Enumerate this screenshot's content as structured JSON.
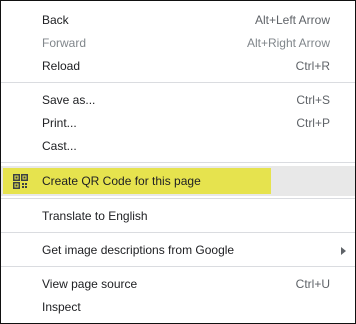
{
  "menu": {
    "back": {
      "label": "Back",
      "shortcut": "Alt+Left Arrow"
    },
    "forward": {
      "label": "Forward",
      "shortcut": "Alt+Right Arrow",
      "disabled": true
    },
    "reload": {
      "label": "Reload",
      "shortcut": "Ctrl+R"
    },
    "save_as": {
      "label": "Save as...",
      "shortcut": "Ctrl+S"
    },
    "print": {
      "label": "Print...",
      "shortcut": "Ctrl+P"
    },
    "cast": {
      "label": "Cast..."
    },
    "qr_code": {
      "label": "Create QR Code for this page",
      "icon": "qr-code-icon",
      "highlighted": true
    },
    "translate": {
      "label": "Translate to English"
    },
    "image_descriptions": {
      "label": "Get image descriptions from Google",
      "has_submenu": true
    },
    "view_source": {
      "label": "View page source",
      "shortcut": "Ctrl+U"
    },
    "inspect": {
      "label": "Inspect"
    }
  },
  "colors": {
    "highlight": "#e6e34e",
    "hover_background": "#e8e8e8",
    "separator": "#dadce0",
    "text": "#202124",
    "shortcut_text": "#5f6368",
    "disabled_text": "#80868b",
    "border": "#111111"
  }
}
